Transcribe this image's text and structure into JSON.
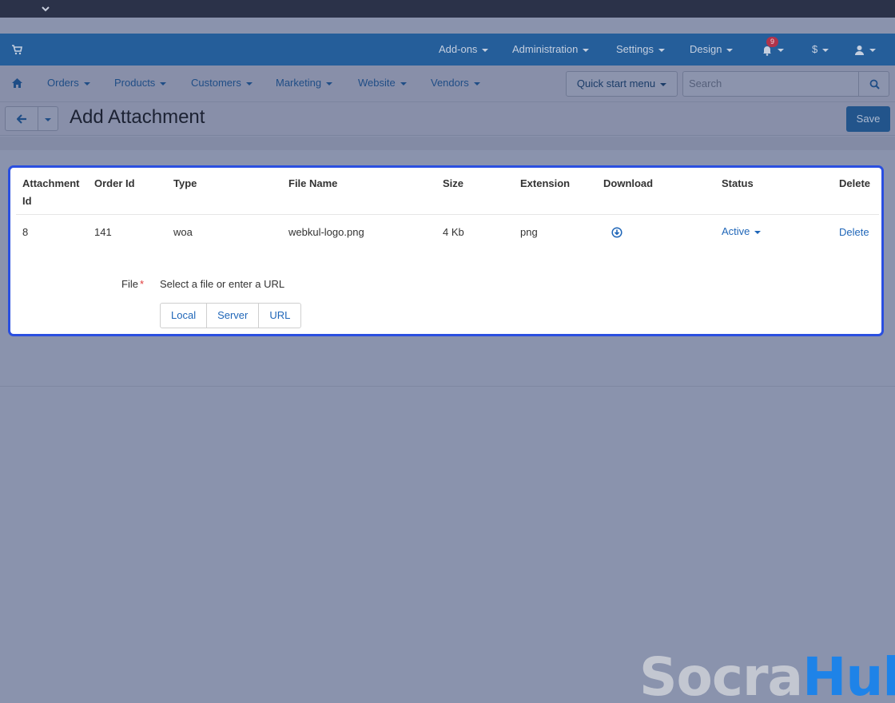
{
  "navbar": {
    "items": [
      {
        "label": "Add-ons"
      },
      {
        "label": "Administration"
      },
      {
        "label": "Settings"
      },
      {
        "label": "Design"
      }
    ],
    "notifications_count": "9",
    "currency": "$"
  },
  "subnav": {
    "items": [
      {
        "label": "Orders"
      },
      {
        "label": "Products"
      },
      {
        "label": "Customers"
      },
      {
        "label": "Marketing"
      },
      {
        "label": "Website"
      },
      {
        "label": "Vendors"
      }
    ],
    "quick_start_label": "Quick start menu",
    "search_placeholder": "Search"
  },
  "header": {
    "title": "Add Attachment",
    "save_label": "Save"
  },
  "table": {
    "columns": [
      "Attachment",
      "Id",
      "Order Id",
      "Type",
      "File Name",
      "Size",
      "Extension",
      "Download",
      "Status",
      "Delete"
    ],
    "rows": [
      {
        "attachment_id": "8",
        "order_id": "141",
        "type": "woa",
        "file_name": "webkul-logo.png",
        "size": "4 Kb",
        "extension": "png",
        "status": "Active",
        "delete": "Delete"
      }
    ]
  },
  "file_field": {
    "label": "File",
    "required_mark": "*",
    "hint": "Select a file or enter a URL",
    "options": [
      "Local",
      "Server",
      "URL"
    ]
  },
  "watermark": {
    "part1": "Socra",
    "part2": "Hub"
  },
  "colors": {
    "navbar": "#255e9a",
    "panel_border": "#2a4fe0",
    "link": "#1f66b8",
    "watermark_accent": "#1e83e8"
  }
}
